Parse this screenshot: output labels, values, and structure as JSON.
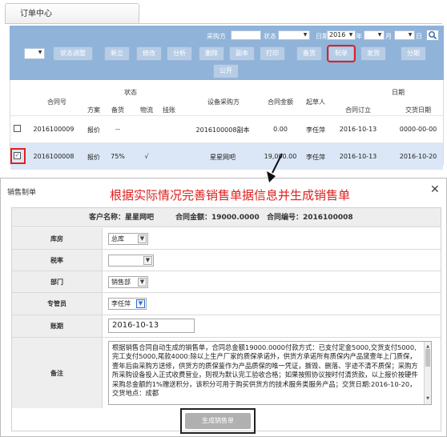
{
  "tab": {
    "label": "订单中心"
  },
  "toolbar": {
    "filters": {
      "purchaser_label": "采购方",
      "status_label": "状态",
      "date_label": "日期",
      "year_value": "2016",
      "year_unit": "年",
      "month_unit": "月",
      "day_unit": "日"
    },
    "buttons": {
      "status_adjust": "状态调整",
      "new": "新立",
      "modify": "修改",
      "analyze": "分析",
      "delete": "删除",
      "copy": "副本",
      "print": "打印",
      "prepare": "备货",
      "make": "制单",
      "ship": "发货",
      "split": "分期",
      "publish": "公开"
    }
  },
  "grid": {
    "headers": {
      "contract_no": "合同号",
      "status_group": "状态",
      "plan": "方案",
      "prepare": "备货",
      "logistics": "物流",
      "hold": "挂账",
      "buyer": "设备采购方",
      "amount": "合同金额",
      "initiator": "起草人",
      "date_group": "日期",
      "sign_date": "合同订立",
      "delivery_date": "交货日期"
    },
    "rows": [
      {
        "contract_no": "2016100009",
        "plan": "报价",
        "prepare": "--",
        "logistics": "",
        "hold": "",
        "buyer": "2016100008副本",
        "amount": "0.00",
        "initiator": "李任萍",
        "sign_date": "2016-10-13",
        "delivery_date": "0000-00-00",
        "checked": false
      },
      {
        "contract_no": "2016100008",
        "plan": "报价",
        "prepare": "75%",
        "logistics": "√",
        "hold": "",
        "buyer": "星星网吧",
        "amount": "19,000.00",
        "initiator": "李任萍",
        "sign_date": "2016-10-13",
        "delivery_date": "2016-10-20",
        "checked": true
      }
    ]
  },
  "dialog": {
    "title": "销售制单",
    "banner": "根据实际情况完善销售单据信息并生成销售单",
    "close_glyph": "✕",
    "summary": {
      "customer": "客户名称：星星网吧",
      "amount": "合同金额：19000.0000",
      "contract_no": "合同编号：2016100008"
    },
    "fields": {
      "warehouse_label": "库房",
      "warehouse_value": "总库",
      "tax_label": "税率",
      "tax_value": "",
      "department_label": "部门",
      "department_value": "销售部",
      "manager_label": "专管员",
      "manager_value": "李任萍",
      "period_label": "账期",
      "period_value": "2016-10-13",
      "remarks_label": "备注",
      "remarks_value": "根据销售合同自动生成的销售单，合同总金额19000.0000付款方式：已支付定金5000,交货支付5000,完工支付5000,尾款4000:除以上生产厂家的质保承诺外，供货方承诺所有质保内产品黛壹年上门质保，壹年后由采购方送修，供货方的质保鉴作为产品质保的唯一凭证，撕毁、删落、字迹不清不质保；采购方所采购设备投入正式收费营业，则视为默认完工验收合格；如果按照协议按时付清货款，以上报价按硬件采购总金额的1%赠送积分，该积分可用于购买供货方的技术服务类服务产品；交货日期:2016-10-20，交货地点：成都"
    },
    "generate_button": "生成销售单"
  }
}
